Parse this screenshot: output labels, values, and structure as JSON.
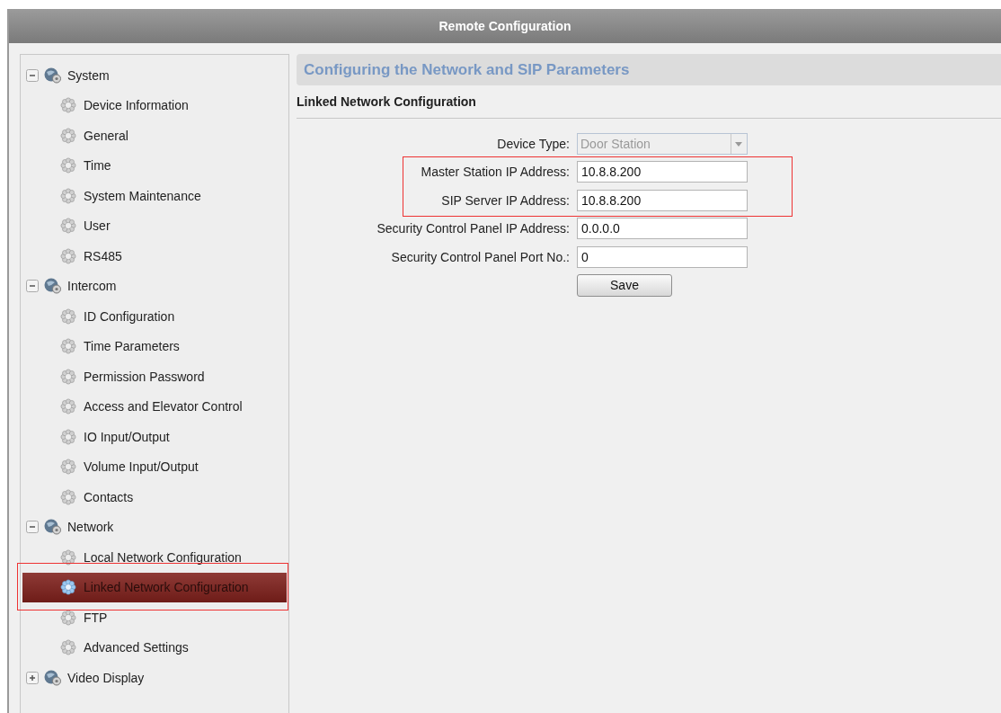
{
  "window": {
    "title": "Remote Configuration"
  },
  "sidebar": {
    "groups": [
      {
        "label": "System",
        "expanded": true,
        "children": [
          {
            "label": "Device Information",
            "selected": false,
            "highlighted": false
          },
          {
            "label": "General",
            "selected": false,
            "highlighted": false
          },
          {
            "label": "Time",
            "selected": false,
            "highlighted": false
          },
          {
            "label": "System Maintenance",
            "selected": false,
            "highlighted": false
          },
          {
            "label": "User",
            "selected": false,
            "highlighted": false
          },
          {
            "label": "RS485",
            "selected": false,
            "highlighted": false
          }
        ]
      },
      {
        "label": "Intercom",
        "expanded": true,
        "children": [
          {
            "label": "ID Configuration",
            "selected": false,
            "highlighted": false
          },
          {
            "label": "Time Parameters",
            "selected": false,
            "highlighted": false
          },
          {
            "label": "Permission Password",
            "selected": false,
            "highlighted": false
          },
          {
            "label": "Access and Elevator Control",
            "selected": false,
            "highlighted": false
          },
          {
            "label": "IO Input/Output",
            "selected": false,
            "highlighted": false
          },
          {
            "label": "Volume Input/Output",
            "selected": false,
            "highlighted": false
          },
          {
            "label": "Contacts",
            "selected": false,
            "highlighted": false
          }
        ]
      },
      {
        "label": "Network",
        "expanded": true,
        "children": [
          {
            "label": "Local Network Configuration",
            "selected": false,
            "highlighted": false
          },
          {
            "label": "Linked Network Configuration",
            "selected": true,
            "highlighted": true
          },
          {
            "label": "FTP",
            "selected": false,
            "highlighted": false
          },
          {
            "label": "Advanced Settings",
            "selected": false,
            "highlighted": false
          }
        ]
      },
      {
        "label": "Video Display",
        "expanded": false
      }
    ]
  },
  "main": {
    "header": "Configuring the Network and SIP Parameters",
    "section_title": "Linked Network Configuration",
    "fields": [
      {
        "kind": "select",
        "label": "Device Type:",
        "value": "Door Station",
        "disabled": true,
        "highlighted": false
      },
      {
        "kind": "text",
        "label": "Master Station IP Address:",
        "value": "10.8.8.200",
        "disabled": false,
        "highlighted": true
      },
      {
        "kind": "text",
        "label": "SIP Server IP Address:",
        "value": "10.8.8.200",
        "disabled": false,
        "highlighted": true
      },
      {
        "kind": "text",
        "label": "Security Control Panel IP Address:",
        "value": "0.0.0.0",
        "disabled": false,
        "highlighted": false
      },
      {
        "kind": "text",
        "label": "Security Control Panel Port No.:",
        "value": "0",
        "disabled": false,
        "highlighted": false
      }
    ],
    "save_button": "Save"
  }
}
